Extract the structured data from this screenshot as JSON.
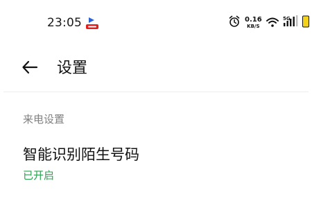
{
  "status_bar": {
    "time": "23:05",
    "net_speed_value": "0.16",
    "net_speed_unit": "KB/S",
    "network_type": "5G",
    "icons": [
      "app-badge-icon",
      "alarm-icon",
      "wifi-icon",
      "cellular-signal-icon",
      "battery-icon"
    ]
  },
  "header": {
    "title": "设置",
    "back_icon": "back-arrow-icon"
  },
  "section": {
    "title": "来电设置"
  },
  "settings": [
    {
      "name": "智能识别陌生号码",
      "status": "已开启"
    }
  ],
  "colors": {
    "background": "#ffffff",
    "text_primary": "#111111",
    "text_secondary": "#808080",
    "status_enabled": "#2aa050",
    "divider": "#eeeeee",
    "battery_fill": "#f2d21b",
    "app_badge_red": "#e02020",
    "app_badge_blue": "#2a62d8"
  }
}
